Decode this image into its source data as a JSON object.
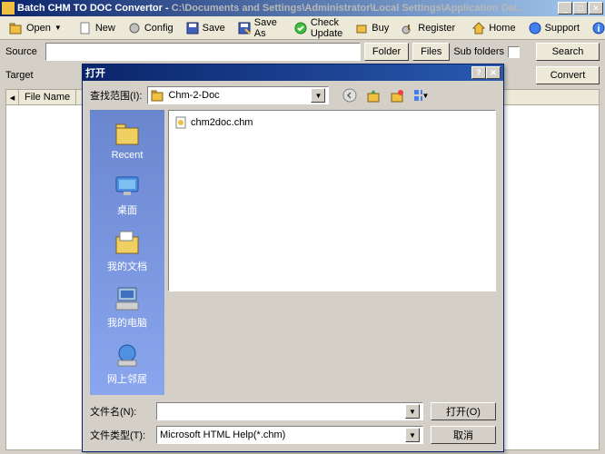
{
  "window": {
    "title_prefix": "Batch CHM TO DOC Convertor - ",
    "title_path": "C:\\Documents and Settings\\Administrator\\Local Settings\\Application Dat..."
  },
  "toolbar": {
    "open": "Open",
    "new": "New",
    "config": "Config",
    "save": "Save",
    "save_as": "Save As",
    "check_update": "Check Update",
    "buy": "Buy",
    "register": "Register",
    "home": "Home",
    "support": "Support",
    "about": "About"
  },
  "form": {
    "source_label": "Source",
    "target_label": "Target",
    "folder_btn": "Folder",
    "files_btn": "Files",
    "subfolders_label": "Sub folders",
    "search_btn": "Search",
    "convert_btn": "Convert"
  },
  "filelist": {
    "col_filename": "File Name"
  },
  "dialog": {
    "title": "打开",
    "lookin_label": "查找范围(I):",
    "lookin_value": "Chm-2-Doc",
    "file_item": "chm2doc.chm",
    "filename_label": "文件名(N):",
    "filename_value": "",
    "filetype_label": "文件类型(T):",
    "filetype_value": "Microsoft HTML Help(*.chm)",
    "open_btn": "打开(O)",
    "cancel_btn": "取消",
    "places": {
      "recent": "Recent",
      "desktop": "桌面",
      "mydocs": "我的文档",
      "mycomputer": "我的电脑",
      "network": "网上邻居"
    }
  }
}
